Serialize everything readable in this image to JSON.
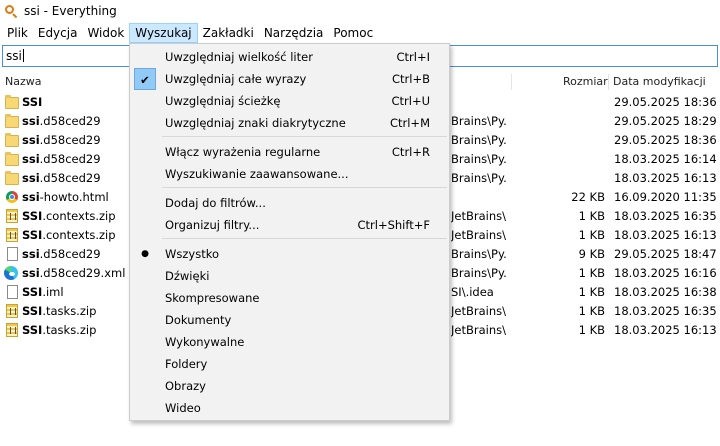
{
  "window": {
    "title": "ssi - Everything",
    "icon": "magnifier-icon"
  },
  "menubar": [
    "Plik",
    "Edycja",
    "Widok",
    "Wyszukaj",
    "Zakładki",
    "Narzędzia",
    "Pomoc"
  ],
  "search": {
    "value": "ssi"
  },
  "columns": {
    "name": "Nazwa",
    "size": "Rozmiar",
    "date": "Data modyfikacji"
  },
  "files": [
    {
      "icon": "folder-icon",
      "name_bold": "SSI",
      "name_rest": "",
      "path": "",
      "size": "",
      "date": "29.05.2025 18:36"
    },
    {
      "icon": "folder-icon",
      "name_bold": "ssi",
      "name_rest": ".d58ced29",
      "path": "Brains\\Py...",
      "size": "",
      "date": "29.05.2025 18:29"
    },
    {
      "icon": "folder-icon",
      "name_bold": "ssi",
      "name_rest": ".d58ced29",
      "path": "Brains\\Py...",
      "size": "",
      "date": "29.05.2025 18:36"
    },
    {
      "icon": "folder-icon",
      "name_bold": "ssi",
      "name_rest": ".d58ced29",
      "path": "Brains\\Py...",
      "size": "",
      "date": "18.03.2025 16:14"
    },
    {
      "icon": "folder-icon",
      "name_bold": "ssi",
      "name_rest": ".d58ced29",
      "path": "Brains\\Py...",
      "size": "",
      "date": "18.03.2025 16:13"
    },
    {
      "icon": "chrome-html-icon",
      "name_bold": "ssi",
      "name_rest": "-howto.html",
      "path": "",
      "size": "22 KB",
      "date": "16.09.2020 11:35"
    },
    {
      "icon": "zip-icon",
      "name_bold": "SSI",
      "name_rest": ".contexts.zip",
      "path": "JetBrains\\...",
      "size": "1 KB",
      "date": "18.03.2025 16:35"
    },
    {
      "icon": "zip-icon",
      "name_bold": "SSI",
      "name_rest": ".contexts.zip",
      "path": "JetBrains\\...",
      "size": "1 KB",
      "date": "18.03.2025 16:13"
    },
    {
      "icon": "file-icon",
      "name_bold": "ssi",
      "name_rest": ".d58ced29",
      "path": "Brains\\Py...",
      "size": "9 KB",
      "date": "29.05.2025 18:47"
    },
    {
      "icon": "edge-xml-icon",
      "name_bold": "ssi",
      "name_rest": ".d58ced29.xml",
      "path": "Brains\\Py...",
      "size": "1 KB",
      "date": "18.03.2025 16:16"
    },
    {
      "icon": "file-icon",
      "name_bold": "SSI",
      "name_rest": ".iml",
      "path": "SI\\.idea",
      "size": "1 KB",
      "date": "18.03.2025 16:38"
    },
    {
      "icon": "zip-icon",
      "name_bold": "SSI",
      "name_rest": ".tasks.zip",
      "path": "JetBrains\\...",
      "size": "1 KB",
      "date": "18.03.2025 16:35"
    },
    {
      "icon": "zip-icon",
      "name_bold": "SSI",
      "name_rest": ".tasks.zip",
      "path": "JetBrains\\...",
      "size": "1 KB",
      "date": "18.03.2025 16:13"
    }
  ],
  "search_menu": {
    "items": [
      {
        "label": "Uwzględniaj wielkość liter",
        "shortcut": "Ctrl+I"
      },
      {
        "label": "Uwzględniaj całe wyrazy",
        "shortcut": "Ctrl+B",
        "checked": true,
        "mark": "✔"
      },
      {
        "label": "Uwzględniaj ścieżkę",
        "shortcut": "Ctrl+U"
      },
      {
        "label": "Uwzględniaj znaki diakrytyczne",
        "shortcut": "Ctrl+M"
      },
      {
        "label": "Włącz wyrażenia regularne",
        "shortcut": "Ctrl+R"
      },
      {
        "label": "Wyszukiwanie zaawansowane...",
        "shortcut": ""
      },
      {
        "label": "Dodaj do filtrów...",
        "shortcut": ""
      },
      {
        "label": "Organizuj filtry...",
        "shortcut": "Ctrl+Shift+F"
      },
      {
        "label": "Wszystko",
        "shortcut": "",
        "selected": true,
        "mark": "●"
      },
      {
        "label": "Dźwięki",
        "shortcut": ""
      },
      {
        "label": "Skompresowane",
        "shortcut": ""
      },
      {
        "label": "Dokumenty",
        "shortcut": ""
      },
      {
        "label": "Wykonywalne",
        "shortcut": ""
      },
      {
        "label": "Foldery",
        "shortcut": ""
      },
      {
        "label": "Obrazy",
        "shortcut": ""
      },
      {
        "label": "Wideo",
        "shortcut": ""
      }
    ]
  },
  "colors": {
    "menu_highlight": "#91c9f7",
    "menubar_open": "#cce8ff",
    "search_border": "#4a90d9"
  }
}
